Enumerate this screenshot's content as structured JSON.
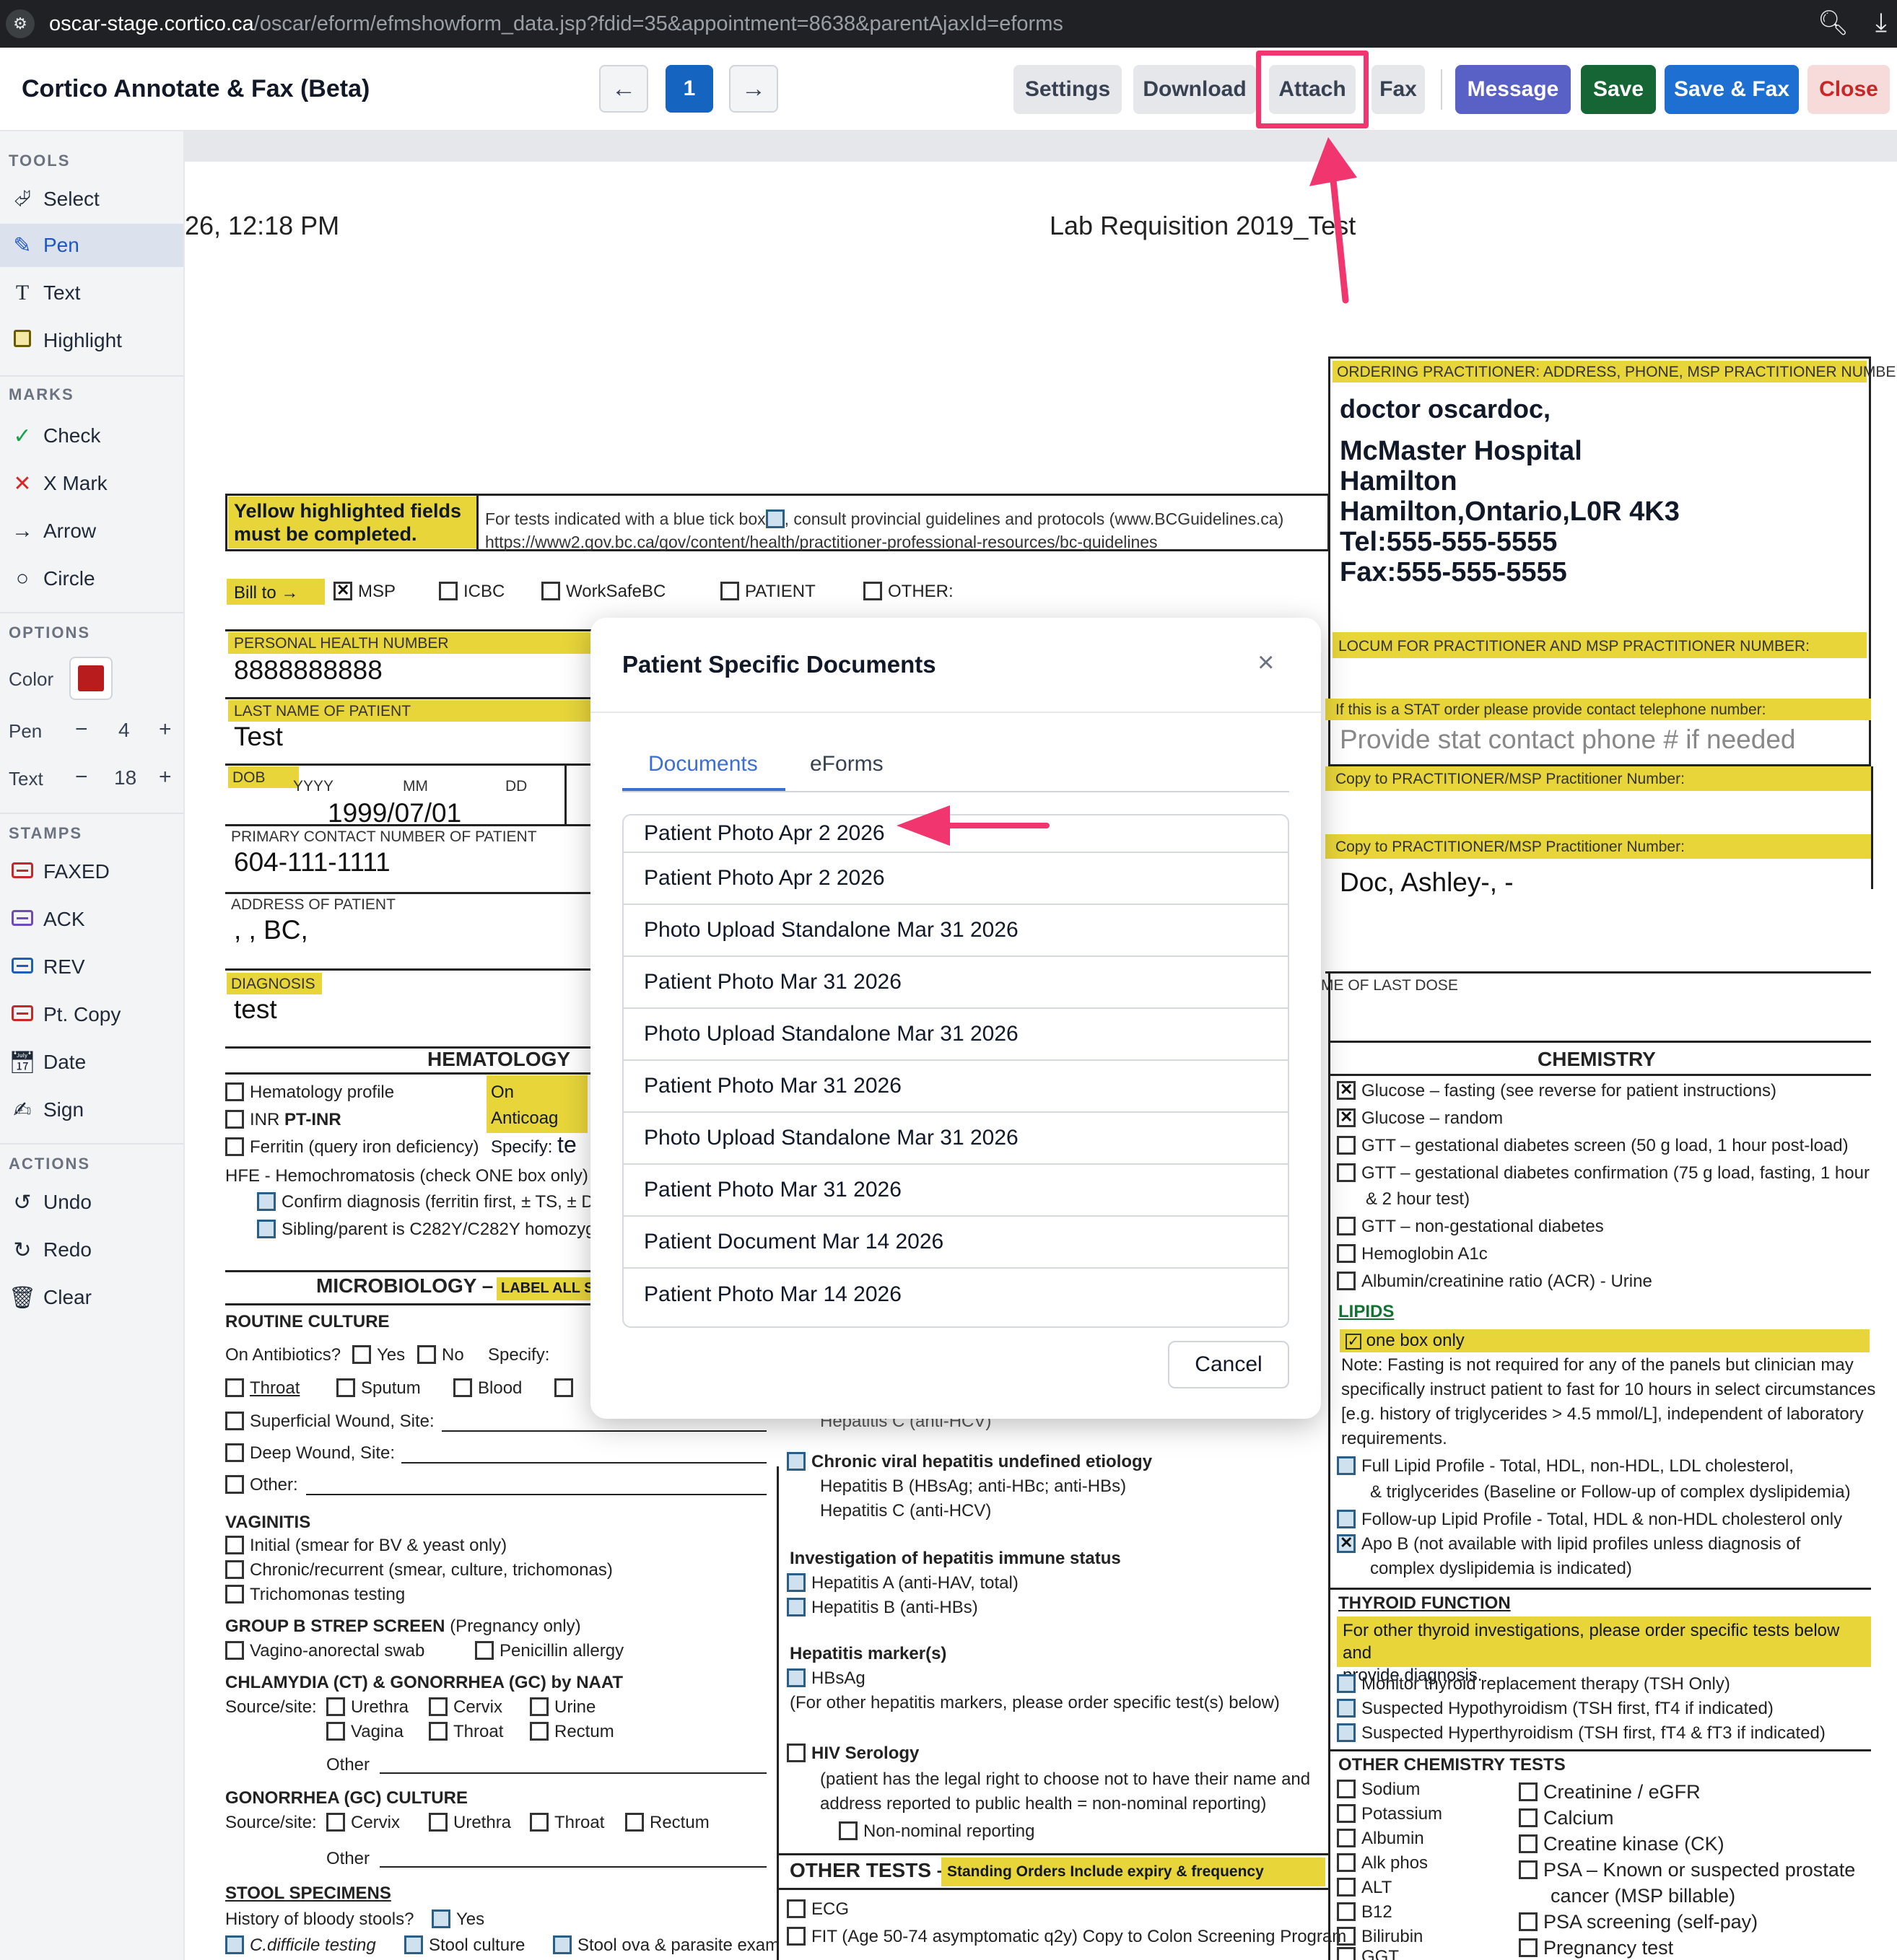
{
  "browser": {
    "url_host": "oscar-stage.cortico.ca",
    "url_path": "/oscar/eform/efmshowform_data.jsp?fdid=35&appointment=8638&parentAjaxId=eforms"
  },
  "app": {
    "title": "Cortico Annotate & Fax (Beta)",
    "page_number": "1",
    "prev_label": "←",
    "next_label": "→",
    "toolbar": {
      "settings": "Settings",
      "download": "Download",
      "attach": "Attach",
      "fax": "Fax",
      "message": "Message",
      "save": "Save",
      "save_fax": "Save & Fax",
      "close": "Close"
    },
    "colors": {
      "annotation": "#f0356f",
      "primary": "#1d6fd1",
      "save": "#166534",
      "message": "#5a61c6",
      "close_text": "#c62828",
      "pen_color": "#b91c1c"
    }
  },
  "sidebar": {
    "tools_label": "TOOLS",
    "tools": [
      "Select",
      "Pen",
      "Text",
      "Highlight"
    ],
    "marks_label": "MARKS",
    "marks": [
      "Check",
      "X Mark",
      "Arrow",
      "Circle"
    ],
    "options_label": "OPTIONS",
    "color_label": "Color",
    "pen_label": "Pen",
    "pen_size": "4",
    "text_label": "Text",
    "text_size": "18",
    "minus": "−",
    "plus": "+",
    "stamps_label": "STAMPS",
    "stamps": [
      "FAXED",
      "ACK",
      "REV",
      "Pt. Copy",
      "Date",
      "Sign"
    ],
    "actions_label": "ACTIONS",
    "actions": [
      "Undo",
      "Redo",
      "Clear"
    ]
  },
  "document": {
    "timestamp": "26, 12:18 PM",
    "form_title": "Lab Requisition 2019_Test",
    "notice_yellow": "Yellow highlighted fields must be completed.",
    "notice_text_1": "For tests indicated with a blue tick box",
    "notice_text_1b": ", consult provincial guidelines and protocols (www.BCGuidelines.ca)",
    "notice_text_2": "https://www2.gov.bc.ca/gov/content/health/practitioner-professional-resources/bc-guidelines",
    "bill_to": "Bill to →",
    "bill_options": [
      "MSP",
      "ICBC",
      "WorkSafeBC",
      "PATIENT",
      "OTHER:"
    ],
    "phn_label": "PERSONAL HEALTH NUMBER",
    "phn": "8888888888",
    "last_name_label": "LAST NAME OF PATIENT",
    "last_name": "Test",
    "dob_label": "DOB",
    "dob_yyyy": "YYYY",
    "dob_mm": "MM",
    "dob_dd": "DD",
    "dob": "1999/07/01",
    "contact_label": "PRIMARY CONTACT NUMBER OF PATIENT",
    "contact": "604-111-1111",
    "address_label": "ADDRESS OF PATIENT",
    "address": ", , BC,",
    "diagnosis_label": "DIAGNOSIS",
    "diagnosis": "test",
    "ordering_label": "ORDERING PRACTITIONER: ADDRESS, PHONE, MSP PRACTITIONER NUMBER",
    "practitioner_lines": [
      "doctor oscardoc,",
      "McMaster Hospital",
      "Hamilton",
      "Hamilton,Ontario,L0R 4K3",
      "Tel:555-555-5555",
      "Fax:555-555-5555"
    ],
    "locum_label": "LOCUM FOR PRACTITIONER AND MSP PRACTITIONER NUMBER:",
    "stat_label": "If this is a STAT order please provide contact telephone number:",
    "stat_placeholder": "Provide stat contact phone # if needed",
    "copy_label_1": "Copy to PRACTITIONER/MSP Practitioner Number:",
    "copy_label_2": "Copy to PRACTITIONER/MSP Practitioner Number:",
    "copy_value_2": "Doc, Ashley-, -",
    "last_dose_label": "ME OF LAST DOSE",
    "hematology": {
      "title": "HEMATOLOGY",
      "items": [
        "Hematology profile",
        "INR",
        "Ferritin (query iron deficiency)"
      ],
      "inr_extra": "PT-INR",
      "anticoag": "On Anticoag",
      "specify": "Specify:",
      "specify_val": "te",
      "hfe": "HFE - Hemochromatosis (check ONE box only)",
      "hfe_items": [
        "Confirm diagnosis (ferritin first, ± TS, ± DN",
        "Sibling/parent is C282Y/C282Y homozyg"
      ]
    },
    "micro": {
      "title": "MICROBIOLOGY –",
      "label_all": "LABEL ALL S",
      "routine": "ROUTINE CULTURE",
      "on_antibiotics": "On Antibiotics?",
      "yes": "Yes",
      "no": "No",
      "specify": "Specify:",
      "row1": [
        "Throat",
        "Sputum",
        "Blood"
      ],
      "lines": [
        "Superficial Wound, Site:",
        "Deep Wound, Site:",
        "Other:"
      ],
      "vaginitis": "VAGINITIS",
      "vag_items": [
        "Initial (smear for BV & yeast only)",
        "Chronic/recurrent (smear, culture, trichomonas)",
        "Trichomonas testing"
      ],
      "gbs": "GROUP B STREP SCREEN",
      "gbs_suffix": "(Pregnancy only)",
      "gbs_items": [
        "Vagino-anorectal swab",
        "Penicillin allergy"
      ],
      "ct": "CHLAMYDIA (CT) & GONORRHEA (GC) by NAAT",
      "source_site": "Source/site:",
      "ct_items_1": [
        "Urethra",
        "Cervix",
        "Urine"
      ],
      "ct_items_2": [
        "Vagina",
        "Throat",
        "Rectum"
      ],
      "other": "Other",
      "gc": "GONORRHEA (GC) CULTURE",
      "gc_items": [
        "Cervix",
        "Urethra",
        "Throat",
        "Rectum"
      ],
      "stool": "STOOL SPECIMENS",
      "bloody": "History of bloody stools?",
      "stool_yes": "Yes",
      "stool_items": [
        "C.difficile testing",
        "Stool culture",
        "Stool ova & parasite exam"
      ]
    },
    "hepatitis": {
      "partial": "Hepatitis C (anti-HCV)",
      "chronic": "Chronic viral hepatitis undefined etiology",
      "chronic_items": [
        "Hepatitis B (HBsAg; anti-HBc; anti-HBs)",
        "Hepatitis C (anti-HCV)"
      ],
      "immune": "Investigation of hepatitis immune status",
      "immune_items": [
        "Hepatitis A (anti-HAV, total)",
        "Hepatitis B (anti-HBs)"
      ],
      "markers": "Hepatitis marker(s)",
      "hbsag": "HBsAg",
      "markers_note": "(For other hepatitis markers, please order specific test(s) below)",
      "hiv": "HIV Serology",
      "hiv_note_1": "(patient has the legal right to choose not to have their name and",
      "hiv_note_2": "address reported to public health = non-nominal reporting)",
      "non_nominal": "Non-nominal reporting"
    },
    "other_tests": {
      "title": "OTHER TESTS –",
      "sub": "Standing Orders Include expiry & frequency",
      "items": [
        "ECG",
        "FIT (Age 50-74 asymptomatic q2y) Copy to Colon Screening Program"
      ]
    },
    "chemistry": {
      "title": "CHEMISTRY",
      "items": [
        "Glucose – fasting (see reverse for patient instructions)",
        "Glucose – random",
        "GTT – gestational diabetes screen (50 g load, 1 hour post-load)",
        "GTT – gestational diabetes confirmation (75 g load, fasting, 1 hour",
        "& 2 hour test)",
        "GTT – non-gestational diabetes",
        "Hemoglobin A1c",
        "Albumin/creatinine ratio (ACR) - Urine"
      ],
      "lipids": "LIPIDS",
      "one_box": "one box only",
      "lipid_note": [
        "Note: Fasting is not required for any of the panels but clinician may",
        "specifically instruct patient to fast for 10 hours in select circumstances",
        "[e.g. history of triglycerides > 4.5 mmol/L], independent of laboratory",
        "requirements."
      ],
      "lipid_items": [
        "Full Lipid Profile - Total, HDL, non-HDL, LDL cholesterol,",
        "& triglycerides (Baseline or Follow-up of complex dyslipidemia)",
        "Follow-up Lipid Profile - Total, HDL & non-HDL cholesterol only",
        "Apo B (not available with lipid profiles unless diagnosis of",
        "complex dyslipidemia is indicated)"
      ],
      "thyroid": "THYROID FUNCTION",
      "thyroid_note": [
        "For other thyroid investigations, please order specific tests below and",
        "provide diagnosis."
      ],
      "thyroid_items": [
        "Monitor thyroid replacement therapy (TSH Only)",
        "Suspected Hypothyroidism (TSH first, fT4 if indicated)",
        "Suspected Hyperthyroidism (TSH first, fT4 & fT3 if indicated)"
      ],
      "other_chem": "OTHER CHEMISTRY TESTS",
      "other_chem_left": [
        "Sodium",
        "Potassium",
        "Albumin",
        "Alk phos",
        "ALT",
        "B12",
        "Bilirubin",
        "GGT"
      ],
      "other_chem_right": [
        "Creatinine / eGFR",
        "Calcium",
        "Creatine kinase (CK)",
        "PSA – Known or suspected prostate",
        "cancer (MSP billable)",
        "PSA screening (self-pay)",
        "Pregnancy test"
      ]
    }
  },
  "modal": {
    "title": "Patient Specific Documents",
    "close": "×",
    "tabs": [
      "Documents",
      "eForms"
    ],
    "active_tab": "Documents",
    "documents": [
      "Patient Photo Apr 2 2026",
      "Patient Photo Apr 2 2026",
      "Photo Upload Standalone Mar 31 2026",
      "Patient Photo Mar 31 2026",
      "Photo Upload Standalone Mar 31 2026",
      "Patient Photo Mar 31 2026",
      "Photo Upload Standalone Mar 31 2026",
      "Patient Photo Mar 31 2026",
      "Patient Document Mar 14 2026",
      "Patient Photo Mar 14 2026"
    ],
    "cancel": "Cancel"
  }
}
